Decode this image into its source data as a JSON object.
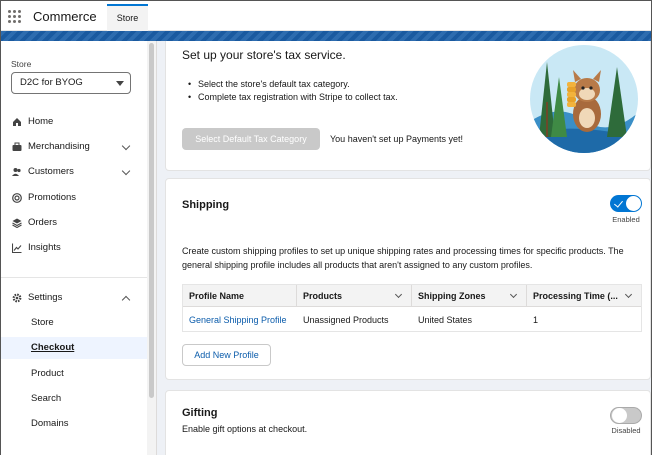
{
  "header": {
    "app_name": "Commerce",
    "tab_label": "Store"
  },
  "sidebar": {
    "store_label": "Store",
    "store_value": "D2C for BYOG",
    "items": [
      {
        "label": "Home",
        "icon": "home-icon"
      },
      {
        "label": "Merchandising",
        "icon": "briefcase-icon",
        "expandable": true
      },
      {
        "label": "Customers",
        "icon": "people-icon",
        "expandable": true
      },
      {
        "label": "Promotions",
        "icon": "target-icon"
      },
      {
        "label": "Orders",
        "icon": "stack-icon"
      },
      {
        "label": "Insights",
        "icon": "chart-icon"
      }
    ],
    "settings": {
      "label": "Settings",
      "icon": "gear-icon",
      "expanded": true,
      "children": [
        "Store",
        "Checkout",
        "Product",
        "Search",
        "Domains"
      ],
      "active": "Checkout"
    }
  },
  "tax": {
    "title": "Set up your store's tax service.",
    "bullets": [
      "Select the store's default tax category.",
      "Complete tax registration with Stripe to collect tax."
    ],
    "button_label": "Select Default Tax Category",
    "note": "You haven't set up Payments yet!"
  },
  "shipping": {
    "title": "Shipping",
    "toggle_label": "Enabled",
    "description": "Create custom shipping profiles to set up unique shipping rates and processing times for specific products. The general shipping profile includes all products that aren't assigned to any custom profiles.",
    "columns": [
      "Profile Name",
      "Products",
      "Shipping Zones",
      "Processing Time (..."
    ],
    "rows": [
      [
        "General Shipping Profile",
        "Unassigned Products",
        "United States",
        "1"
      ]
    ],
    "add_button": "Add New Profile"
  },
  "gifting": {
    "title": "Gifting",
    "description": "Enable gift options at checkout.",
    "toggle_label": "Disabled"
  },
  "colors": {
    "brand_blue": "#0176d3",
    "link_blue": "#0b5cab",
    "band_blue": "#1b5fa8"
  }
}
